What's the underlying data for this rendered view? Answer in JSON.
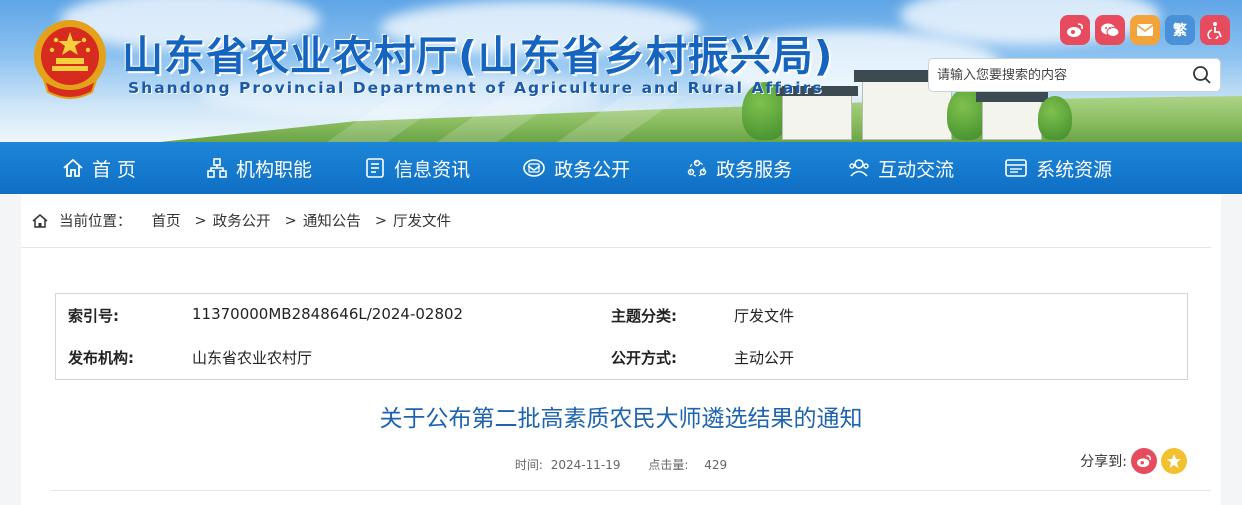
{
  "header": {
    "site_title": "山东省农业农村厅(山东省乡村振兴局)",
    "site_subtitle": "Shandong Provincial Department of Agriculture and Rural Affairs",
    "social": [
      {
        "name": "weibo-icon",
        "glyph": "",
        "color": "#e64b5e"
      },
      {
        "name": "wechat-icon",
        "glyph": "",
        "color": "#e64b5e"
      },
      {
        "name": "mail-icon",
        "glyph": "",
        "color": "#f2a33a"
      },
      {
        "name": "traditional-chinese-icon",
        "glyph": "繁",
        "color": "#4a90d9"
      },
      {
        "name": "accessibility-icon",
        "glyph": "",
        "color": "#e64b5e"
      }
    ],
    "search_placeholder": "请输入您要搜索的内容"
  },
  "nav": [
    {
      "label": "首 页",
      "icon": "home-icon"
    },
    {
      "label": "机构职能",
      "icon": "org-icon"
    },
    {
      "label": "信息资讯",
      "icon": "news-icon"
    },
    {
      "label": "政务公开",
      "icon": "disclosure-icon"
    },
    {
      "label": "政务服务",
      "icon": "service-icon"
    },
    {
      "label": "互动交流",
      "icon": "interaction-icon"
    },
    {
      "label": "系统资源",
      "icon": "resource-icon"
    }
  ],
  "breadcrumb": {
    "prefix": "当前位置：",
    "items": [
      "首页",
      "政务公开",
      "通知公告",
      "厅发文件"
    ],
    "separator": ">"
  },
  "meta": {
    "index_label": "索引号:",
    "index_value": "11370000MB2848646L/2024-02802",
    "topic_label": "主题分类:",
    "topic_value": "厅发文件",
    "publisher_label": "发布机构:",
    "publisher_value": "山东省农业农村厅",
    "open_label": "公开方式:",
    "open_value": "主动公开"
  },
  "article": {
    "title": "关于公布第二批高素质农民大师遴选结果的通知",
    "time_label": "时间:",
    "time_value": "2024-11-19",
    "views_label": "点击量:",
    "views_value": "429",
    "share_label": "分享到:"
  }
}
